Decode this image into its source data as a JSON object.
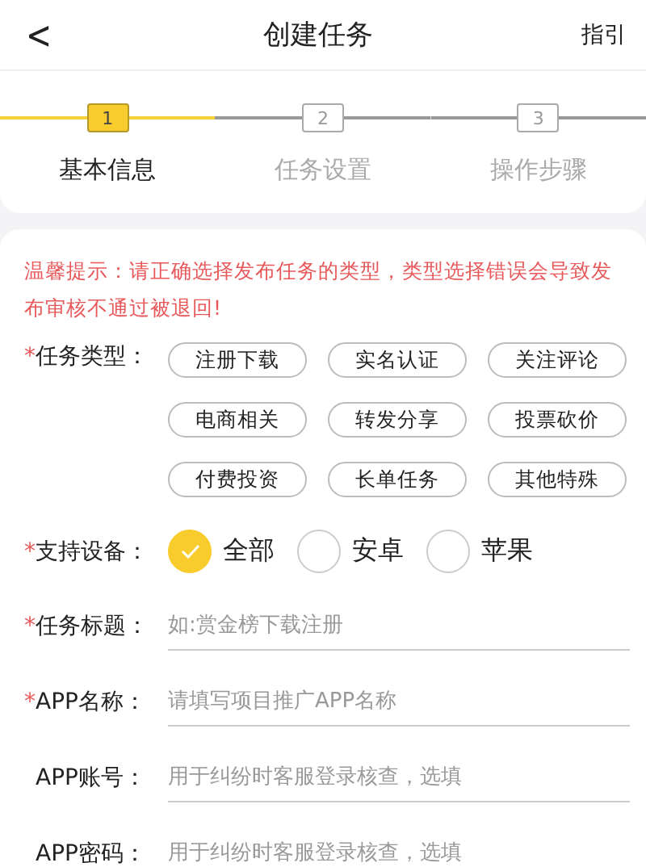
{
  "header": {
    "back": "<",
    "title": "创建任务",
    "action": "指引"
  },
  "steps": [
    {
      "number": "1",
      "label": "基本信息",
      "active": true
    },
    {
      "number": "2",
      "label": "任务设置",
      "active": false
    },
    {
      "number": "3",
      "label": "操作步骤",
      "active": false
    }
  ],
  "notice": "温馨提示：请正确选择发布任务的类型，类型选择错误会导致发布审核不通过被退回!",
  "task_type": {
    "mark": "*",
    "label": "任务类型：",
    "options": [
      {
        "label": "注册下载",
        "selected": false
      },
      {
        "label": "实名认证",
        "selected": false
      },
      {
        "label": "关注评论",
        "selected": false
      },
      {
        "label": "电商相关",
        "selected": false
      },
      {
        "label": "转发分享",
        "selected": false
      },
      {
        "label": "投票砍价",
        "selected": false
      },
      {
        "label": "付费投资",
        "selected": false
      },
      {
        "label": "长单任务",
        "selected": false
      },
      {
        "label": "其他特殊",
        "selected": false
      }
    ]
  },
  "device": {
    "mark": "*",
    "label": "支持设备：",
    "options": [
      {
        "label": "全部",
        "selected": true
      },
      {
        "label": "安卓",
        "selected": false
      },
      {
        "label": "苹果",
        "selected": false
      }
    ]
  },
  "fields": [
    {
      "mark": "*",
      "label": "任务标题：",
      "placeholder": "如:赏金榜下载注册"
    },
    {
      "mark": "*",
      "label": "APP名称：",
      "placeholder": "请填写项目推广APP名称"
    },
    {
      "label": "APP账号：",
      "placeholder": "用于纠纷时客服登录核查，选填"
    },
    {
      "label": "APP密码：",
      "placeholder": "用于纠纷时客服登录核查，选填"
    }
  ]
}
